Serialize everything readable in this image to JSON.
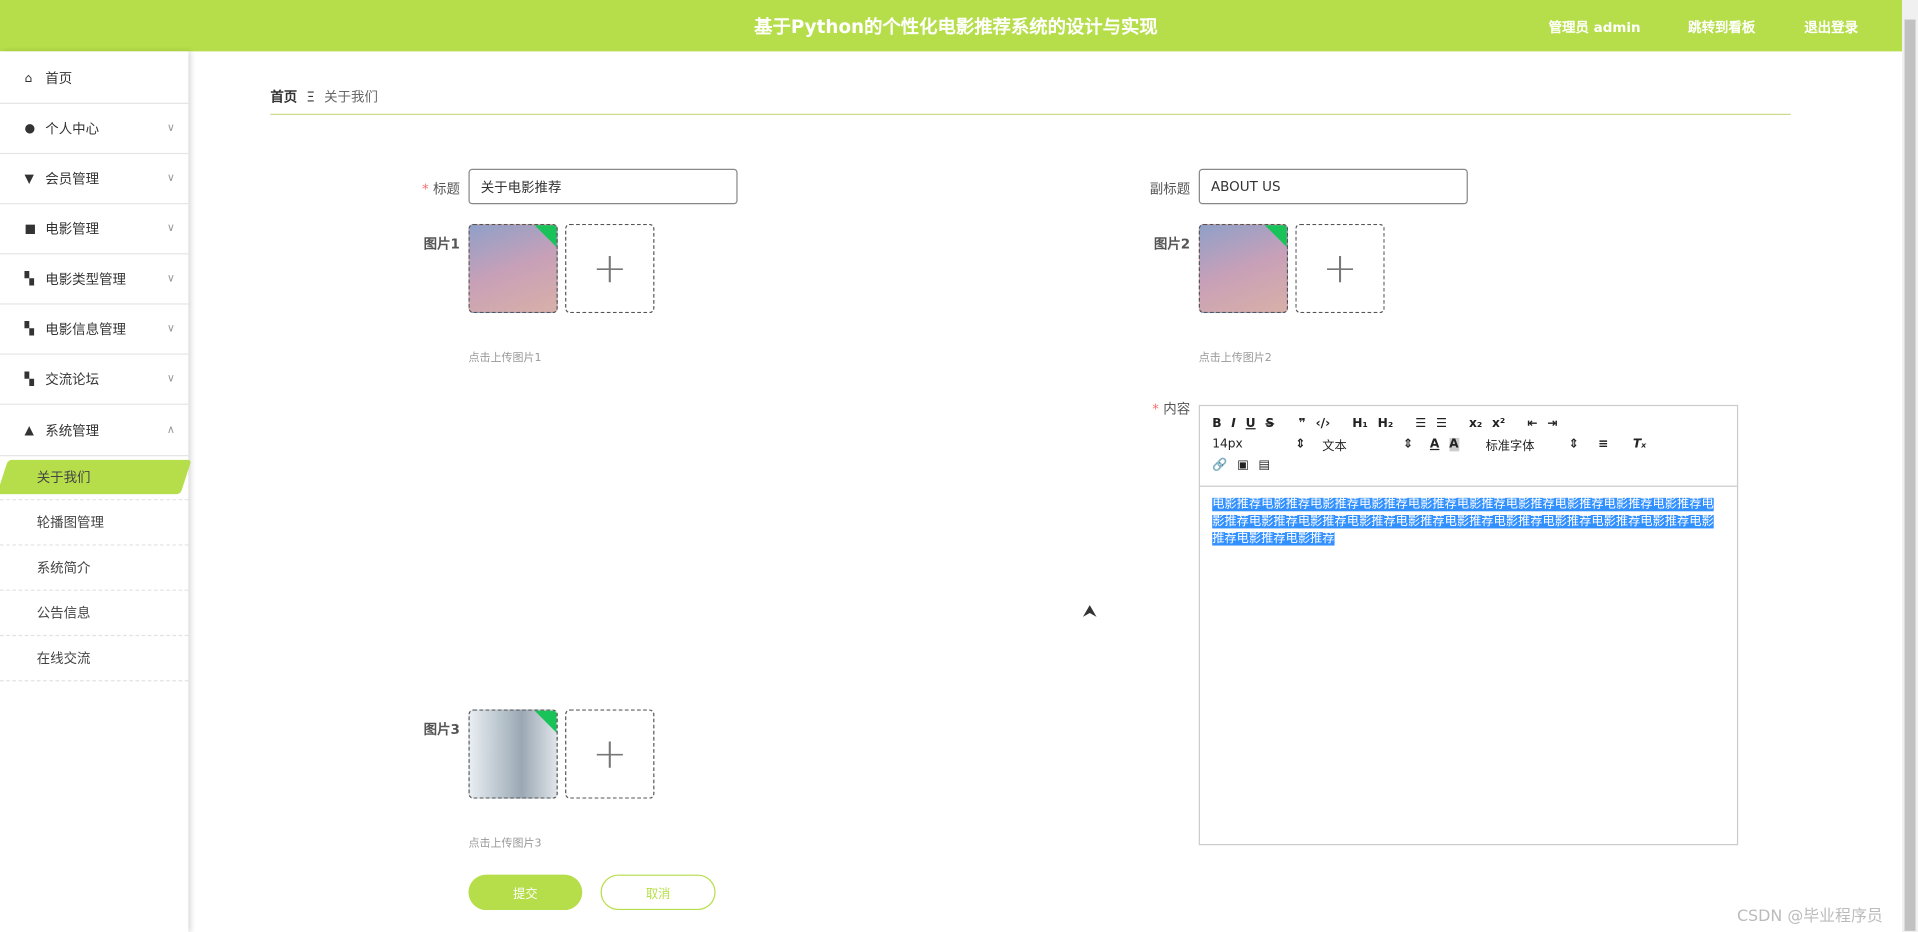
{
  "header": {
    "title": "基于Python的个性化电影推荐系统的设计与实现",
    "user": "管理员 admin",
    "dashboard": "跳转到看板",
    "logout": "退出登录",
    "color": "#b6de4a"
  },
  "sidebar": {
    "items": [
      {
        "label": "首页",
        "icon": "home-icon"
      },
      {
        "label": "个人中心",
        "icon": "user-icon"
      },
      {
        "label": "会员管理",
        "icon": "pin-icon"
      },
      {
        "label": "电影管理",
        "icon": "briefcase-icon"
      },
      {
        "label": "电影类型管理",
        "icon": "grid-icon"
      },
      {
        "label": "电影信息管理",
        "icon": "grid-icon"
      },
      {
        "label": "交流论坛",
        "icon": "grid-icon"
      },
      {
        "label": "系统管理",
        "icon": "users-icon"
      }
    ],
    "subitems": [
      {
        "label": "关于我们"
      },
      {
        "label": "轮播图管理"
      },
      {
        "label": "系统简介"
      },
      {
        "label": "公告信息"
      },
      {
        "label": "在线交流"
      }
    ]
  },
  "breadcrumb": {
    "home": "首页",
    "sep": "Ξ",
    "current": "关于我们"
  },
  "form": {
    "title_label": "标题",
    "title_value": "关于电影推荐",
    "subtitle_label": "副标题",
    "subtitle_value": "ABOUT US",
    "pic1_label": "图片1",
    "pic1_hint": "点击上传图片1",
    "pic2_label": "图片2",
    "pic2_hint": "点击上传图片2",
    "pic3_label": "图片3",
    "pic3_hint": "点击上传图片3",
    "content_label": "内容",
    "submit": "提交",
    "cancel": "取消"
  },
  "editor": {
    "font_size": "14px",
    "block": "文本",
    "font": "标准字体",
    "content": "电影推荐电影推荐电影推荐电影推荐电影推荐电影推荐电影推荐电影推荐电影推荐电影推荐电影推荐电影推荐电影推荐电影推荐电影推荐电影推荐电影推荐电影推荐电影推荐电影推荐电影推荐电影推荐电影推荐"
  },
  "watermark": "CSDN @毕业程序员"
}
